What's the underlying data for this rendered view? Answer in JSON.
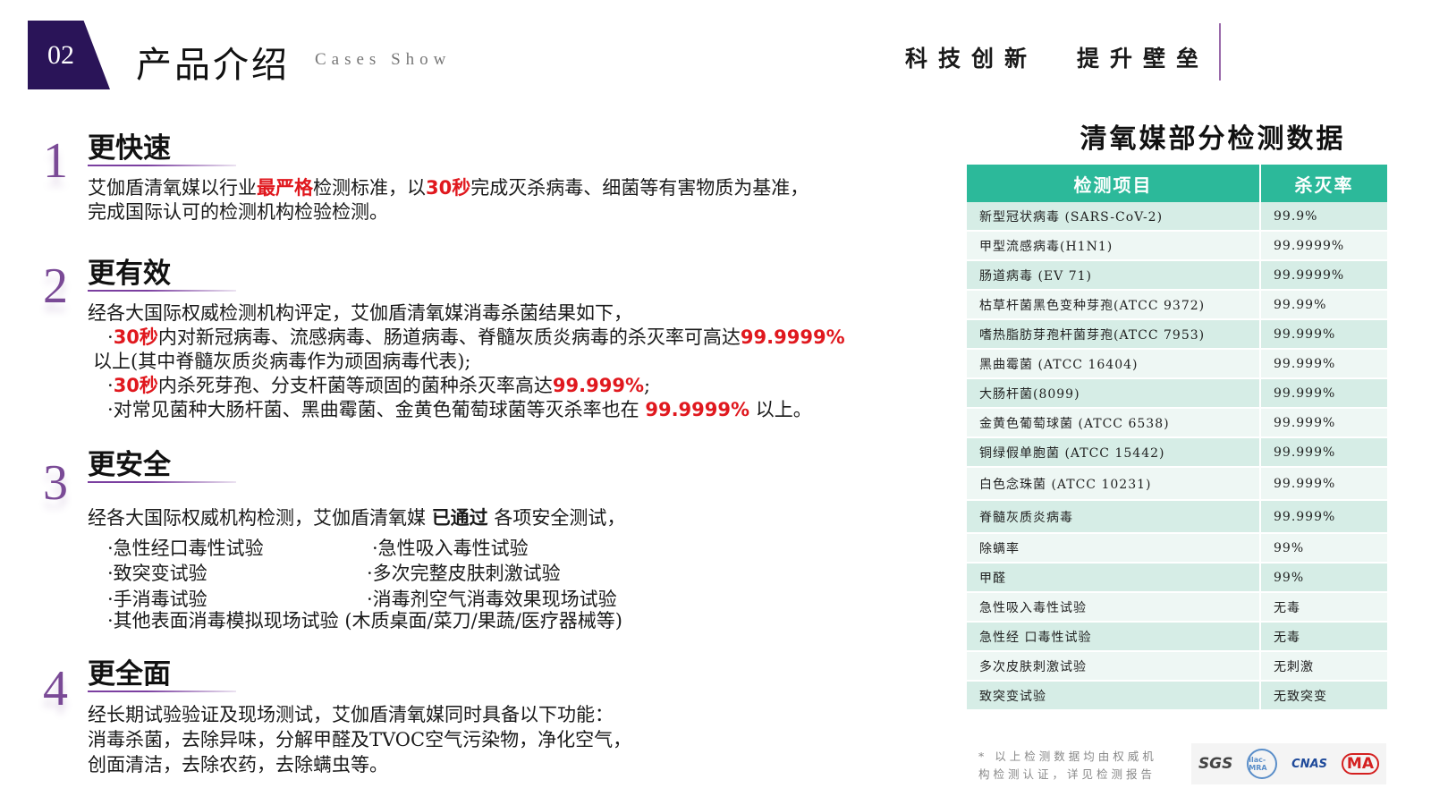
{
  "header": {
    "badge_number": "02",
    "title": "产品介绍",
    "subtitle": "Cases Show",
    "slogan_1": "科技创新",
    "slogan_2": "提升壁垒"
  },
  "sections": [
    {
      "number": "1",
      "title": "更快速",
      "body": {
        "l1_a": "艾伽盾清氧媒以行业",
        "l1_red1": "最严格",
        "l1_b": "检测标准，以",
        "l1_red2": "30秒",
        "l1_c": "完成灭杀病毒、细菌等有害物质为基准，",
        "l2": "完成国际认可的检测机构检验检测。"
      }
    },
    {
      "number": "2",
      "title": "更有效",
      "body": {
        "l1": "经各大国际权威检测机构评定，艾伽盾清氧媒消毒杀菌结果如下，",
        "l2_dot": "·",
        "l2_red1": "30秒",
        "l2_a": "内对新冠病毒、流感病毒、肠道病毒、脊髓灰质炎病毒的杀灭率可高达",
        "l2_red2": "99.9999%",
        "l3": "以上(其中脊髓灰质炎病毒作为顽固病毒代表);",
        "l4_dot": "·",
        "l4_red1": "30秒",
        "l4_a": "内杀死芽孢、分支杆菌等顽固的菌种杀灭率高达",
        "l4_red2": "99.999%",
        "l4_b": ";",
        "l5_a": "·对常见菌种大肠杆菌、黑曲霉菌、金黄色葡萄球菌等灭杀率也在 ",
        "l5_red": "99.9999%",
        "l5_b": " 以上。"
      }
    },
    {
      "number": "3",
      "title": "更安全",
      "body": {
        "l1_a": "经各大国际权威机构检测，艾伽盾清氧媒 ",
        "l1_bold": "已通过",
        "l1_b": " 各项安全测试，",
        "tests_left": [
          "·急性经口毒性试验",
          "·致突变试验",
          "·手消毒试验"
        ],
        "tests_right": [
          "·急性吸入毒性试验",
          "·多次完整皮肤刺激试验",
          "·消毒剂空气消毒效果现场试验"
        ],
        "l_last": "·其他表面消毒模拟现场试验 (木质桌面/菜刀/果蔬/医疗器械等)"
      }
    },
    {
      "number": "4",
      "title": "更全面",
      "body": {
        "l1": "经长期试验验证及现场测试，艾伽盾清氧媒同时具备以下功能：",
        "l2": "消毒杀菌，去除异味，分解甲醛及TVOC空气污染物，净化空气，",
        "l3": "创面清洁，去除农药，去除螨虫等。"
      }
    }
  ],
  "table": {
    "title": "清氧媒部分检测数据",
    "headers": [
      "检测项目",
      "杀灭率"
    ],
    "rows": [
      [
        "新型冠状病毒    (SARS-CoV-2)",
        "99.9%"
      ],
      [
        "甲型流感病毒(H1N1)",
        "99.9999%"
      ],
      [
        "肠道病毒 (EV 71)",
        "99.9999%"
      ],
      [
        "枯草杆菌黑色变种芽孢(ATCC 9372)",
        "99.99%"
      ],
      [
        "嗜热脂肪芽孢杆菌芽孢(ATCC 7953)",
        "99.999%"
      ],
      [
        "黑曲霉菌 (ATCC 16404)",
        "99.999%"
      ],
      [
        "大肠杆菌(8099)",
        "99.999%"
      ],
      [
        "金黄色葡萄球菌 (ATCC 6538)",
        "99.999%"
      ],
      [
        "铜绿假单胞菌 (ATCC 15442)",
        "99.999%"
      ],
      [
        "白色念珠菌 (ATCC 10231)",
        "99.999%"
      ],
      [
        "脊髓灰质炎病毒",
        "99.999%"
      ],
      [
        "除螨率",
        "99%"
      ],
      [
        "甲醛",
        "99%"
      ],
      [
        "急性吸入毒性试验",
        "无毒"
      ],
      [
        "急性经 口毒性试验",
        "无毒"
      ],
      [
        "多次皮肤刺激试验",
        "无刺激"
      ],
      [
        "致突变试验",
        "无致突变"
      ]
    ],
    "footnote_1": "* 以上检测数据均由权威机",
    "footnote_2": "构检测认证，详见检测报告",
    "logos": [
      "SGS",
      "ilac-MRA",
      "CNAS",
      "MA"
    ]
  },
  "colors": {
    "badge": "#2a1458",
    "accent_purple": "#7b3fa0",
    "highlight_red": "#e0181e",
    "table_header": "#2cb99a",
    "table_row_a": "#d6ede6",
    "table_row_b": "#eef7f4"
  }
}
